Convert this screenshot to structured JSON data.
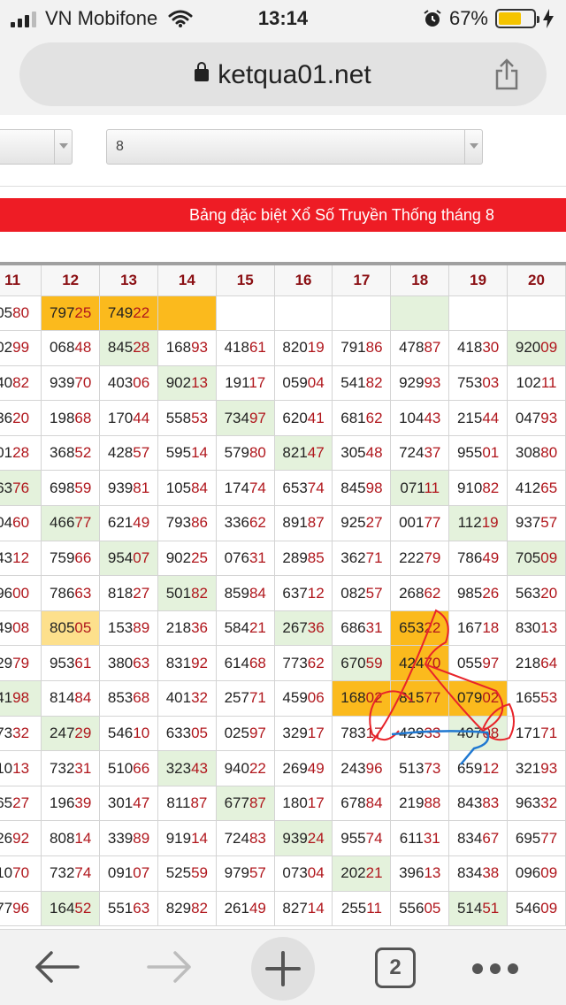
{
  "status": {
    "carrier": "VN Mobifone",
    "time": "13:14",
    "battery": "67%",
    "battery_level": 0.67
  },
  "browser": {
    "url": "ketqua01.net",
    "tab_count": "2"
  },
  "selects": {
    "month_value": "8"
  },
  "banner": "Bảng đặc biệt Xổ Số Truyền Thống tháng 8",
  "columns": [
    "11",
    "12",
    "13",
    "14",
    "15",
    "16",
    "17",
    "18",
    "19",
    "20"
  ],
  "rows": [
    [
      "0580",
      "79725",
      "74922",
      "",
      "",
      "",
      "",
      "",
      "",
      ""
    ],
    [
      "0299",
      "06848",
      "84528",
      "16893",
      "41861",
      "82019",
      "79186",
      "47887",
      "41830",
      "92009"
    ],
    [
      "4082",
      "93970",
      "40306",
      "90213",
      "19117",
      "05904",
      "54182",
      "92993",
      "75303",
      "10211"
    ],
    [
      "3620",
      "19868",
      "17044",
      "55853",
      "73497",
      "62041",
      "68162",
      "10443",
      "21544",
      "04793"
    ],
    [
      "0128",
      "36852",
      "42857",
      "59514",
      "57980",
      "82147",
      "30548",
      "72437",
      "95501",
      "30880"
    ],
    [
      "6376",
      "69859",
      "93981",
      "10584",
      "17474",
      "65374",
      "84598",
      "07111",
      "91082",
      "41265"
    ],
    [
      "0460",
      "46677",
      "62149",
      "79386",
      "33662",
      "89187",
      "92527",
      "00177",
      "11219",
      "93757"
    ],
    [
      "4312",
      "75966",
      "95407",
      "90225",
      "07631",
      "28985",
      "36271",
      "22279",
      "78649",
      "70509"
    ],
    [
      "9600",
      "78663",
      "81827",
      "50182",
      "85984",
      "63712",
      "08257",
      "26862",
      "98526",
      "56320"
    ],
    [
      "4908",
      "80505",
      "15389",
      "21836",
      "58421",
      "26736",
      "68631",
      "65322",
      "16718",
      "83013"
    ],
    [
      "2979",
      "95361",
      "38063",
      "83192",
      "61468",
      "77362",
      "67059",
      "42470",
      "05597",
      "21864"
    ],
    [
      "4198",
      "81484",
      "85368",
      "40132",
      "25771",
      "45906",
      "16802",
      "81577",
      "07902",
      "16553"
    ],
    [
      "7332",
      "24729",
      "54610",
      "63305",
      "02597",
      "32917",
      "78317",
      "42933",
      "40708",
      "17171"
    ],
    [
      "1013",
      "73231",
      "51066",
      "32343",
      "94022",
      "26949",
      "24396",
      "51373",
      "65912",
      "32193"
    ],
    [
      "6527",
      "19639",
      "30147",
      "81187",
      "67787",
      "18017",
      "67884",
      "21988",
      "84383",
      "96332"
    ],
    [
      "2692",
      "80814",
      "33989",
      "91914",
      "72483",
      "93924",
      "95574",
      "61131",
      "83467",
      "69577"
    ],
    [
      "1070",
      "73274",
      "09107",
      "52559",
      "97957",
      "07304",
      "20221",
      "39613",
      "83438",
      "09609"
    ],
    [
      "7796",
      "16452",
      "55163",
      "82982",
      "26149",
      "82714",
      "25511",
      "55605",
      "51451",
      "54609"
    ]
  ],
  "highlights": [
    {
      "row": 0,
      "col": 1,
      "color": "orange"
    },
    {
      "row": 0,
      "col": 2,
      "color": "orange"
    },
    {
      "row": 0,
      "col": 3,
      "color": "orange"
    },
    {
      "row": 0,
      "col": 7,
      "color": "green"
    },
    {
      "row": 1,
      "col": 2,
      "color": "green"
    },
    {
      "row": 1,
      "col": 9,
      "color": "green"
    },
    {
      "row": 2,
      "col": 3,
      "color": "green"
    },
    {
      "row": 3,
      "col": 4,
      "color": "green"
    },
    {
      "row": 4,
      "col": 5,
      "color": "green"
    },
    {
      "row": 5,
      "col": 0,
      "color": "green"
    },
    {
      "row": 5,
      "col": 7,
      "color": "green"
    },
    {
      "row": 6,
      "col": 1,
      "color": "green"
    },
    {
      "row": 6,
      "col": 8,
      "color": "green"
    },
    {
      "row": 7,
      "col": 2,
      "color": "green"
    },
    {
      "row": 7,
      "col": 9,
      "color": "green"
    },
    {
      "row": 8,
      "col": 3,
      "color": "green"
    },
    {
      "row": 9,
      "col": 1,
      "color": "yellow"
    },
    {
      "row": 9,
      "col": 5,
      "color": "green"
    },
    {
      "row": 9,
      "col": 7,
      "color": "orange"
    },
    {
      "row": 10,
      "col": 6,
      "color": "green"
    },
    {
      "row": 10,
      "col": 7,
      "color": "orange"
    },
    {
      "row": 11,
      "col": 0,
      "color": "green"
    },
    {
      "row": 11,
      "col": 6,
      "color": "orange"
    },
    {
      "row": 11,
      "col": 7,
      "color": "orange"
    },
    {
      "row": 11,
      "col": 8,
      "color": "orange"
    },
    {
      "row": 12,
      "col": 1,
      "color": "green"
    },
    {
      "row": 12,
      "col": 8,
      "color": "green"
    },
    {
      "row": 13,
      "col": 3,
      "color": "green"
    },
    {
      "row": 14,
      "col": 4,
      "color": "green"
    },
    {
      "row": 15,
      "col": 5,
      "color": "green"
    },
    {
      "row": 16,
      "col": 6,
      "color": "green"
    },
    {
      "row": 17,
      "col": 1,
      "color": "green"
    },
    {
      "row": 17,
      "col": 8,
      "color": "green"
    }
  ],
  "colors": {
    "banner": "#ee1c25",
    "header_text": "#8b1014",
    "highlight_orange": "#fbba1d",
    "highlight_green": "#e4f2dc",
    "highlight_yellow": "#fde08c",
    "number_suffix": "#b0161c"
  },
  "icons": [
    "signal-icon",
    "wifi-icon",
    "alarm-icon",
    "battery-icon",
    "charging-icon",
    "lock-icon",
    "share-icon",
    "back-arrow-icon",
    "forward-arrow-icon",
    "plus-icon",
    "tabs-icon",
    "more-icon"
  ]
}
